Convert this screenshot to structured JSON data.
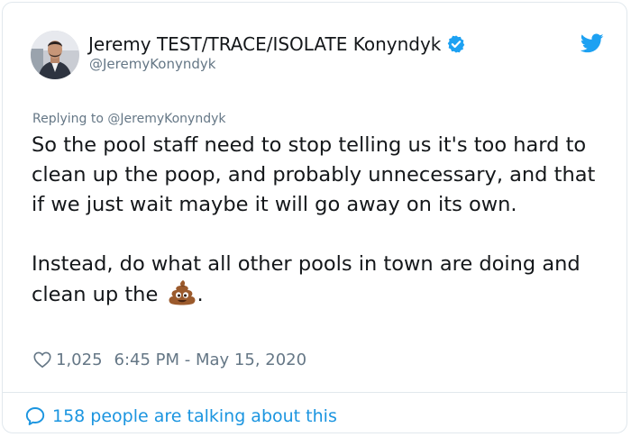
{
  "author": {
    "display_name": "Jeremy TEST/TRACE/ISOLATE Konyndyk",
    "handle": "@JeremyKonyndyk",
    "verified": true
  },
  "reply": {
    "prefix": "Replying to ",
    "mention": "@JeremyKonyndyk"
  },
  "tweet": {
    "paragraph1": "So the pool staff need to stop telling us it's too hard to clean up the poop, and probably unnecessary, and that if we just wait maybe it will go away on its own.",
    "paragraph2_text": "Instead, do what all other pools in town are doing and clean up the",
    "paragraph2_end": ".",
    "emoji": "pile-of-poo-emoji"
  },
  "stats": {
    "likes": "1,025",
    "timestamp": "6:45 PM - May 15, 2020"
  },
  "footer": {
    "talking_label": "158 people are talking about this"
  },
  "icons": {
    "verified": "verified-badge-icon",
    "twitter": "twitter-bird-icon",
    "heart": "heart-icon",
    "bubble": "speech-bubble-icon"
  },
  "colors": {
    "brand_blue": "#1da1f2",
    "link_blue": "#1b95e0",
    "text_primary": "#14171a",
    "text_secondary": "#657786",
    "border": "#e1e8ed"
  }
}
